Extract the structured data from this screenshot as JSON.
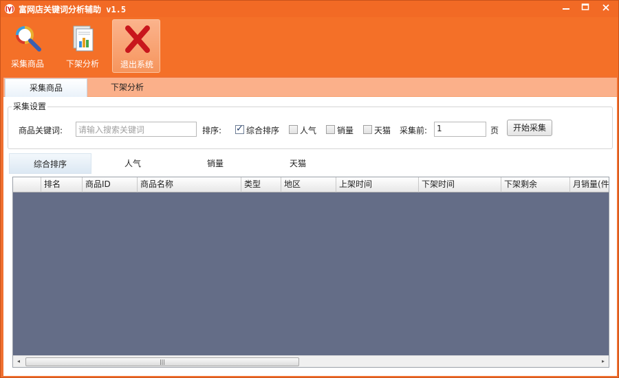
{
  "window": {
    "title": "富网店关键词分析辅助 v1.5",
    "controls": {
      "minimize": "▭",
      "maximize": "□",
      "close": "✕"
    },
    "accent": "#f26522"
  },
  "toolbar": {
    "items": [
      {
        "label": "采集商品",
        "icon": "search-icon"
      },
      {
        "label": "下架分析",
        "icon": "report-icon"
      },
      {
        "label": "退出系统",
        "icon": "exit-x-icon"
      }
    ]
  },
  "main_tabs": [
    {
      "label": "采集商品",
      "active": true
    },
    {
      "label": "下架分析",
      "active": false
    }
  ],
  "settings": {
    "legend": "采集设置",
    "keyword_label": "商品关键词:",
    "keyword_placeholder": "请输入搜索关键词",
    "sort_label": "排序:",
    "sort_options": [
      {
        "label": "综合排序",
        "checked": true
      },
      {
        "label": "人气",
        "checked": false
      },
      {
        "label": "销量",
        "checked": false
      },
      {
        "label": "天猫",
        "checked": false
      }
    ],
    "pages_label": "采集前:",
    "pages_value": "1",
    "pages_unit": "页",
    "start_button": "开始采集"
  },
  "sub_tabs": [
    {
      "label": "综合排序",
      "active": true
    },
    {
      "label": "人气",
      "active": false
    },
    {
      "label": "销量",
      "active": false
    },
    {
      "label": "天猫",
      "active": false
    }
  ],
  "grid": {
    "columns": [
      "",
      "排名",
      "商品ID",
      "商品名称",
      "类型",
      "地区",
      "上架时间",
      "下架时间",
      "下架剩余",
      "月销量(件"
    ],
    "rows": [],
    "scroll": {
      "left": "◂",
      "right": "▸",
      "grip": "|||"
    }
  }
}
